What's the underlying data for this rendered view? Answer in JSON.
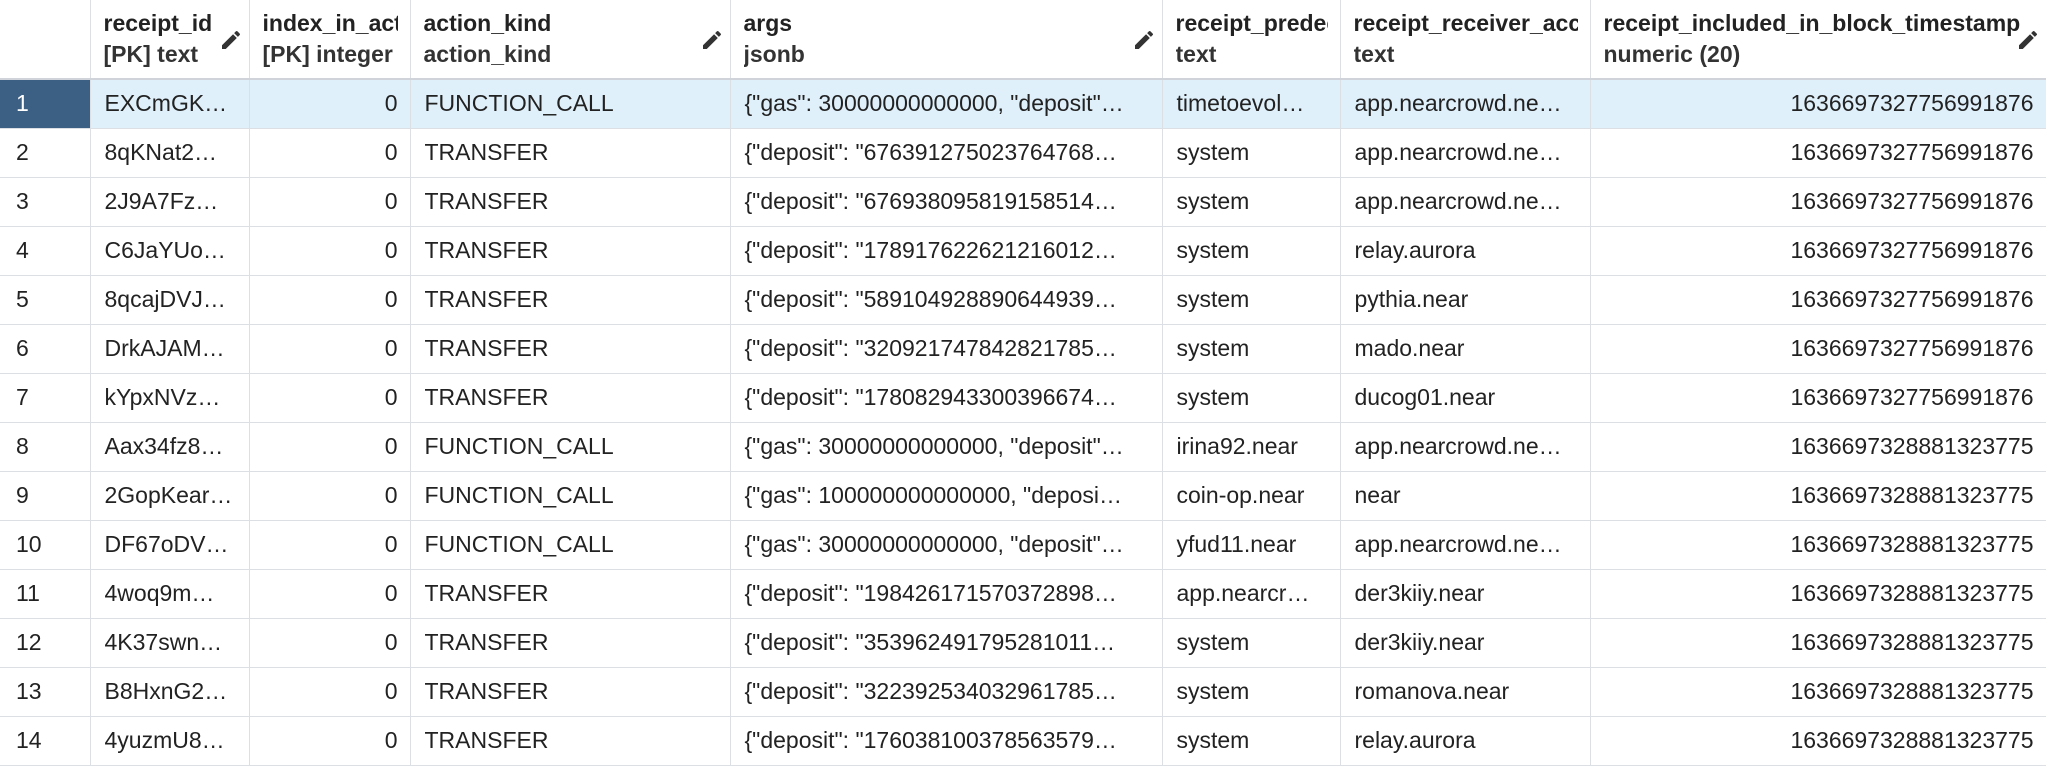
{
  "columns": [
    {
      "name": "receipt_id",
      "type": "[PK] text",
      "editable": true
    },
    {
      "name": "index_in_action_receipt",
      "type": "[PK] integer",
      "editable": false
    },
    {
      "name": "action_kind",
      "type": "action_kind",
      "editable": true
    },
    {
      "name": "args",
      "type": "jsonb",
      "editable": true
    },
    {
      "name": "receipt_predecessor_account_id",
      "type": "text",
      "editable": false
    },
    {
      "name": "receipt_receiver_account_id",
      "type": "text",
      "editable": false
    },
    {
      "name": "receipt_included_in_block_timestamp",
      "type": "numeric (20)",
      "editable": true
    }
  ],
  "rows": [
    {
      "n": "1",
      "receipt_id": "EXCmGK…",
      "index": "0",
      "kind": "FUNCTION_CALL",
      "args": "{\"gas\": 30000000000000, \"deposit\"…",
      "pred": "timetoevol…",
      "recv": "app.nearcrowd.ne…",
      "ts": "1636697327756991876"
    },
    {
      "n": "2",
      "receipt_id": "8qKNat2…",
      "index": "0",
      "kind": "TRANSFER",
      "args": "{\"deposit\": \"676391275023764768…",
      "pred": "system",
      "recv": "app.nearcrowd.ne…",
      "ts": "1636697327756991876"
    },
    {
      "n": "3",
      "receipt_id": "2J9A7Fz…",
      "index": "0",
      "kind": "TRANSFER",
      "args": "{\"deposit\": \"676938095819158514…",
      "pred": "system",
      "recv": "app.nearcrowd.ne…",
      "ts": "1636697327756991876"
    },
    {
      "n": "4",
      "receipt_id": "C6JaYUo…",
      "index": "0",
      "kind": "TRANSFER",
      "args": "{\"deposit\": \"178917622621216012…",
      "pred": "system",
      "recv": "relay.aurora",
      "ts": "1636697327756991876"
    },
    {
      "n": "5",
      "receipt_id": "8qcajDVJ…",
      "index": "0",
      "kind": "TRANSFER",
      "args": "{\"deposit\": \"589104928890644939…",
      "pred": "system",
      "recv": "pythia.near",
      "ts": "1636697327756991876"
    },
    {
      "n": "6",
      "receipt_id": "DrkAJAM…",
      "index": "0",
      "kind": "TRANSFER",
      "args": "{\"deposit\": \"320921747842821785…",
      "pred": "system",
      "recv": "mado.near",
      "ts": "1636697327756991876"
    },
    {
      "n": "7",
      "receipt_id": "kYpxNVz…",
      "index": "0",
      "kind": "TRANSFER",
      "args": "{\"deposit\": \"178082943300396674…",
      "pred": "system",
      "recv": "ducog01.near",
      "ts": "1636697327756991876"
    },
    {
      "n": "8",
      "receipt_id": "Aax34fz8…",
      "index": "0",
      "kind": "FUNCTION_CALL",
      "args": "{\"gas\": 30000000000000, \"deposit\"…",
      "pred": "irina92.near",
      "recv": "app.nearcrowd.ne…",
      "ts": "1636697328881323775"
    },
    {
      "n": "9",
      "receipt_id": "2GopKear…",
      "index": "0",
      "kind": "FUNCTION_CALL",
      "args": "{\"gas\": 100000000000000, \"deposi…",
      "pred": "coin-op.near",
      "recv": "near",
      "ts": "1636697328881323775"
    },
    {
      "n": "10",
      "receipt_id": "DF67oDV…",
      "index": "0",
      "kind": "FUNCTION_CALL",
      "args": "{\"gas\": 30000000000000, \"deposit\"…",
      "pred": "yfud11.near",
      "recv": "app.nearcrowd.ne…",
      "ts": "1636697328881323775"
    },
    {
      "n": "11",
      "receipt_id": "4woq9m…",
      "index": "0",
      "kind": "TRANSFER",
      "args": "{\"deposit\": \"198426171570372898…",
      "pred": "app.nearcr…",
      "recv": "der3kiiy.near",
      "ts": "1636697328881323775"
    },
    {
      "n": "12",
      "receipt_id": "4K37swn…",
      "index": "0",
      "kind": "TRANSFER",
      "args": "{\"deposit\": \"353962491795281011…",
      "pred": "system",
      "recv": "der3kiiy.near",
      "ts": "1636697328881323775"
    },
    {
      "n": "13",
      "receipt_id": "B8HxnG2…",
      "index": "0",
      "kind": "TRANSFER",
      "args": "{\"deposit\": \"322392534032961785…",
      "pred": "system",
      "recv": "romanova.near",
      "ts": "1636697328881323775"
    },
    {
      "n": "14",
      "receipt_id": "4yuzmU8…",
      "index": "0",
      "kind": "TRANSFER",
      "args": "{\"deposit\": \"176038100378563579…",
      "pred": "system",
      "recv": "relay.aurora",
      "ts": "1636697328881323775"
    }
  ],
  "selected_row": 0,
  "icons": {
    "edit": "pencil-icon"
  },
  "colors": {
    "selected_row_bg": "#dff0fb",
    "selected_rownum_bg": "#3c5f84",
    "border": "#dcdfe4"
  }
}
